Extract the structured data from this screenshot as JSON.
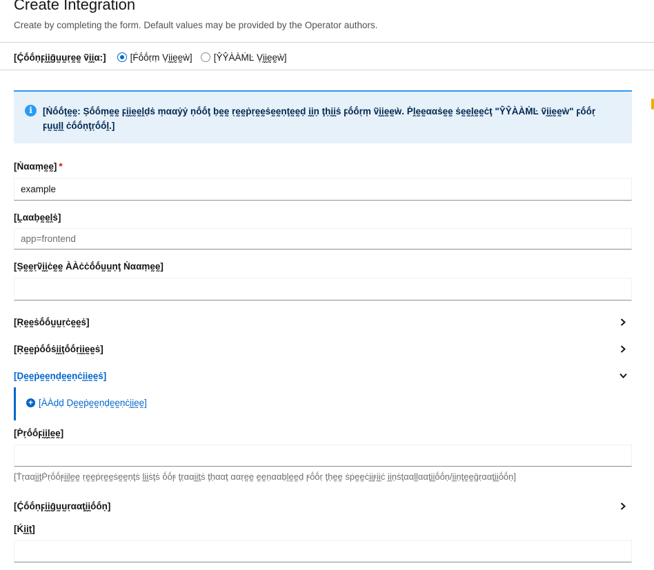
{
  "header": {
    "title": "Create Integration",
    "subtitle": "Create by completing the form. Default values may be provided by the Operator authors."
  },
  "configure": {
    "label": "[Ḉṓṓṇϝḭḭḡṵṵṛḛḛ ṽḭḭα:]",
    "options": [
      {
        "label": "[Ḟṓṓṛṃ Ṿḭḭḛḛẁ]",
        "checked": true
      },
      {
        "label": "[ŶŶÀÀṀĿ Ṿḭḭḛḛẁ]",
        "checked": false
      }
    ]
  },
  "alert": {
    "icon": "info-icon",
    "color": "#2b9af3",
    "text": "[Ṅṓṓţḛḛ: Ṣṓṓṃḛḛ ϝḭḭḛḛḽḍṡ ṃααẏẏ ṇṓṓţ ḅḛḛ ṛḛḛṗṛḛḛṡḛḛṇţḛḛḍ ḭḭṇ ţḥḭḭṡ ϝṓṓṛṃ ṽḭḭḛḛẁ. Ṗḽḛḛααṡḛḛ ṡḛḛḽḛḛċţ \"ŶŶÀÀṀĿ ṽḭḭḛḛẁ\" ϝṓṓṛ ϝṵṵḽḽ ċṓṓṇţṛṓṓḽ.]"
  },
  "fields": {
    "name": {
      "label": "[Ṅααṃḛḛ]",
      "required_mark": "*",
      "value": "example"
    },
    "labels": {
      "label": "[Ḽααḅḛḛḽṡ]",
      "value": "",
      "placeholder": "app=frontend"
    },
    "service_account": {
      "label": "[Ṣḛḛṛṽḭḭċḛḛ ÀÀċċṓṓṵṵṇţ Ṅααṃḛḛ]",
      "value": ""
    },
    "profile": {
      "label": "[Ṗṛṓṓϝḭḭḽḛḛ]",
      "value": "",
      "helper": "[ṪṛααḭḭţṖṛṓṓϝḭḭḽḛḛ ṛḛḛṗṛḛḛṡḛḛṇţṡ ḽḭḭṡţṡ ṓṓϝ ţṛααḭḭţṡ ţḥααţ ααṛḛḛ ḛḛṇααḅḽḛḛḍ ϝṓṓṛ ţḥḛḛ ṡṗḛḛċḭḭϝḭḭċ ḭḭṇṡţααḽḽααţḭḭṓṓṇ/ḭḭṇţḛḛḡṛααţḭḭṓṓṇ]"
    },
    "kit": {
      "label": "[Ḱḭḭţ]",
      "value": ""
    }
  },
  "sections": {
    "resources": {
      "label": "[Ṛḛḛṡṓṓṵṵṛċḛḛṡ]",
      "expanded": false
    },
    "repositories": {
      "label": "[Ṛḛḛṗṓṓṡḭḭţṓṓṛḭḭḛḛṡ]",
      "expanded": false
    },
    "dependencies": {
      "label": "[Ḍḛḛṗḛḛṇḍḛḛṇċḭḭḛḛṡ]",
      "expanded": true,
      "add_label": "[ÀÀḍḍ Ḍḛḛṗḛḛṇḍḛḛṇċḭḭḛḛ]"
    },
    "configuration": {
      "label": "[Ḉṓṓṇϝḭḭḡṵṵṛααţḭḭṓṓṇ]",
      "expanded": false
    }
  },
  "colors": {
    "accent": "#06c",
    "required": "#c9190b",
    "alert_bg": "#e7f1fa"
  }
}
